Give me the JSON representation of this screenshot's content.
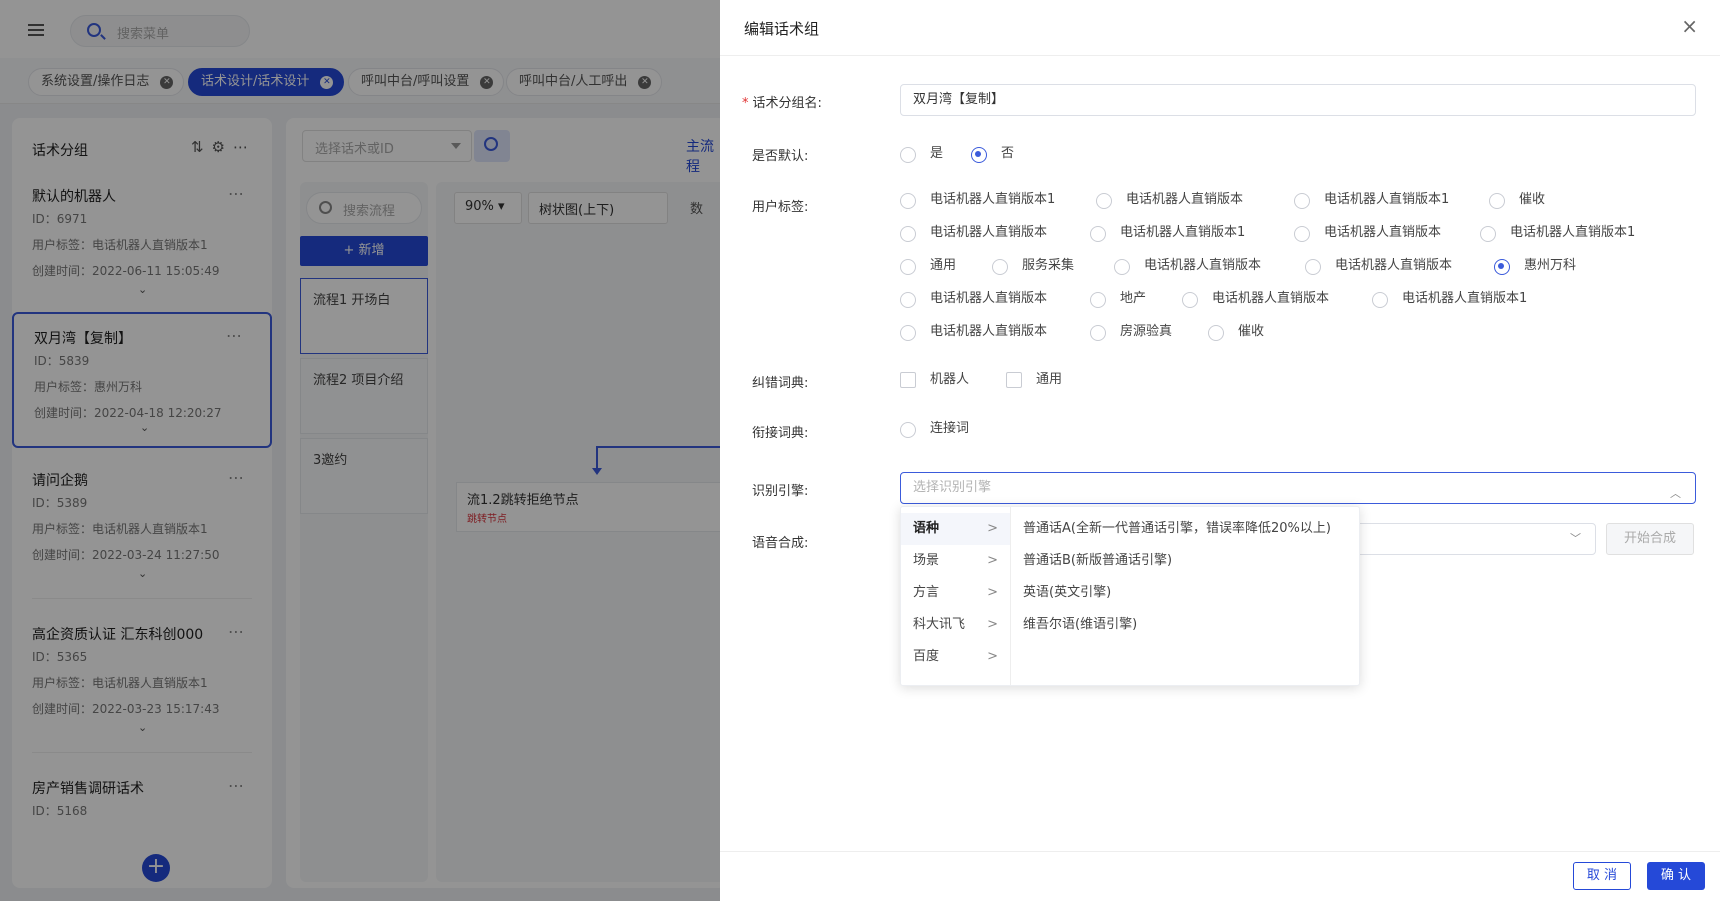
{
  "header": {
    "menu_search_placeholder": "搜索菜单"
  },
  "tabs": [
    {
      "label": "系统设置/操作日志",
      "active": false
    },
    {
      "label": "话术设计/话术设计",
      "active": true
    },
    {
      "label": "呼叫中台/呼叫设置",
      "active": false
    },
    {
      "label": "呼叫中台/人工呼出",
      "active": false
    }
  ],
  "left_panel": {
    "title": "话术分组",
    "label_id": "ID：",
    "label_tag": "用户标签：",
    "label_time": "创建时间：",
    "groups": [
      {
        "name": "默认的机器人",
        "id": "6971",
        "tag": "电话机器人直销版本1",
        "time": "2022-06-11 15:05:49",
        "selected": false
      },
      {
        "name": "双月湾【复制】",
        "id": "5839",
        "tag": "惠州万科",
        "time": "2022-04-18 12:20:27",
        "selected": true
      },
      {
        "name": "请问企鹅",
        "id": "5389",
        "tag": "电话机器人直销版本1",
        "time": "2022-03-24 11:27:50",
        "selected": false
      },
      {
        "name": "高企资质认证 汇东科创000",
        "id": "5365",
        "tag": "电话机器人直销版本1",
        "time": "2022-03-23 15:17:43",
        "selected": false
      },
      {
        "name": "房产销售调研话术",
        "id": "5168"
      }
    ]
  },
  "middle": {
    "select_placeholder": "选择话术或ID",
    "main_tab": "主流程",
    "flow_search_placeholder": "搜索流程",
    "add_label": "+ 新增",
    "flows": [
      "流程1 开场白",
      "流程2 项目介绍",
      "3邀约"
    ],
    "zoom": "90% ▾",
    "view": "树状图(上下)",
    "trail": "数",
    "node_title": "流1.2跳转拒绝节点",
    "node_tag": "跳转节点"
  },
  "drawer": {
    "title": "编辑话术组",
    "close": "×",
    "fields": {
      "name_label": "话术分组名:",
      "name_value": "双月湾【复制】",
      "default_label": "是否默认:",
      "default_yes": "是",
      "default_no": "否",
      "tags_label": "用户标签:",
      "correction_label": "纠错词典:",
      "connect_label": "衔接词典:",
      "engine_label": "识别引擎:",
      "engine_placeholder": "选择识别引擎",
      "tts_label": "语音合成:",
      "tts_button": "开始合成"
    },
    "tags": [
      [
        "电话机器人直销版本1",
        "电话机器人直销版本",
        "电话机器人直销版本1",
        "催收"
      ],
      [
        "电话机器人直销版本",
        "电话机器人直销版本1",
        "电话机器人直销版本",
        "电话机器人直销版本1"
      ],
      [
        "通用",
        "服务采集",
        "电话机器人直销版本",
        "电话机器人直销版本",
        "惠州万科"
      ],
      [
        "电话机器人直销版本",
        "地产",
        "电话机器人直销版本",
        "电话机器人直销版本1"
      ],
      [
        "电话机器人直销版本",
        "房源验真",
        "催收"
      ]
    ],
    "selected_tag": "惠州万科",
    "correction_options": [
      "机器人",
      "通用"
    ],
    "connect_options": [
      "连接词"
    ],
    "cascader": {
      "categories": [
        "语种",
        "场景",
        "方言",
        "科大讯飞",
        "百度"
      ],
      "options": [
        "普通话A(全新一代普通话引擎，错误率降低20%以上)",
        "普通话B(新版普通话引擎)",
        "英语(英文引擎)",
        "维吾尔语(维语引擎)"
      ]
    },
    "footer": {
      "cancel": "取 消",
      "ok": "确 认"
    }
  },
  "colors": {
    "primary": "#2549d8",
    "danger": "#e03131"
  }
}
